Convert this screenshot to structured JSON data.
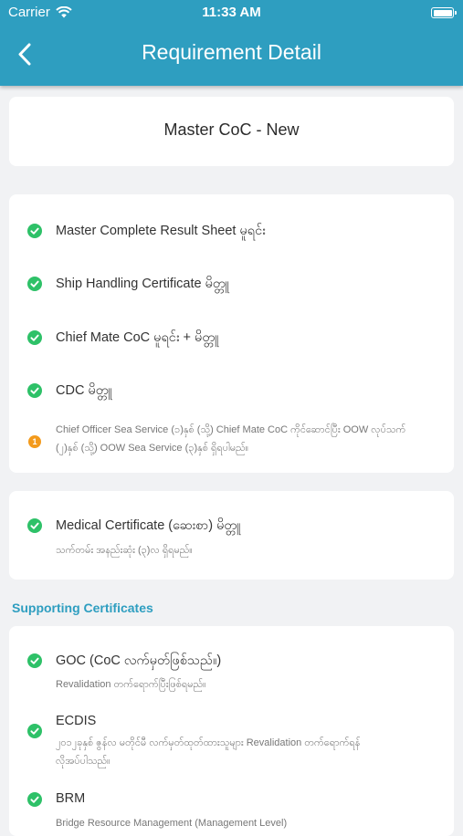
{
  "status_bar": {
    "carrier": "Carrier",
    "time": "11:33 AM"
  },
  "header": {
    "title": "Requirement Detail"
  },
  "requirement": {
    "title": "Master CoC - New"
  },
  "requirements": [
    {
      "label": "Master Complete Result Sheet မူရင်း",
      "status": "complete"
    },
    {
      "label": "Ship Handling Certificate မိတ္တူ",
      "status": "complete"
    },
    {
      "label": "Chief Mate CoC မူရင်း + မိတ္တူ",
      "status": "complete"
    },
    {
      "label": "CDC မိတ္တူ",
      "status": "complete"
    },
    {
      "note_line1": "Chief Officer Sea Service (၁)နှစ် (သို့) Chief Mate CoC ကိုင်ဆောင်ပြီး OOW လုပ်သက်",
      "note_line2": "(၂)နှစ် (သို့) OOW Sea Service (၃)နှစ် ရှိရပါမည်။",
      "badge": "1",
      "status": "pending"
    }
  ],
  "medical": {
    "label": "Medical Certificate (ဆေးစာ) မိတ္တူ",
    "sub": "သက်တမ်း အနည်းဆုံး (၃)လ ရှိရမည်။",
    "status": "complete"
  },
  "supporting": {
    "heading": "Supporting Certificates",
    "items": [
      {
        "label": "GOC (CoC လက်မှတ်ဖြစ်သည်။)",
        "sub": "Revalidation တက်ရောက်ပြီးဖြစ်ရမည်။",
        "status": "complete"
      },
      {
        "label": "ECDIS",
        "sub_line1": "၂၀၁၂ခုနှစ် ဇွန်လ မတိုင်မီ လက်မှတ်ထုတ်ထားသူများ Revalidation တက်ရောက်ရန်",
        "sub_line2": "လိုအပ်ပါသည်။",
        "status": "complete"
      },
      {
        "label": "BRM",
        "sub": "Bridge Resource Management (Management Level)",
        "status": "complete"
      }
    ]
  },
  "colors": {
    "header": "#2e9ec0",
    "check": "#2ec168",
    "warning": "#f39a1c",
    "background": "#f1f2f4"
  },
  "icons": {
    "back": "chevron-left-icon",
    "check": "checkmark-circle-icon",
    "warning": "numbered-badge-icon",
    "wifi": "wifi-icon",
    "battery": "battery-icon"
  }
}
